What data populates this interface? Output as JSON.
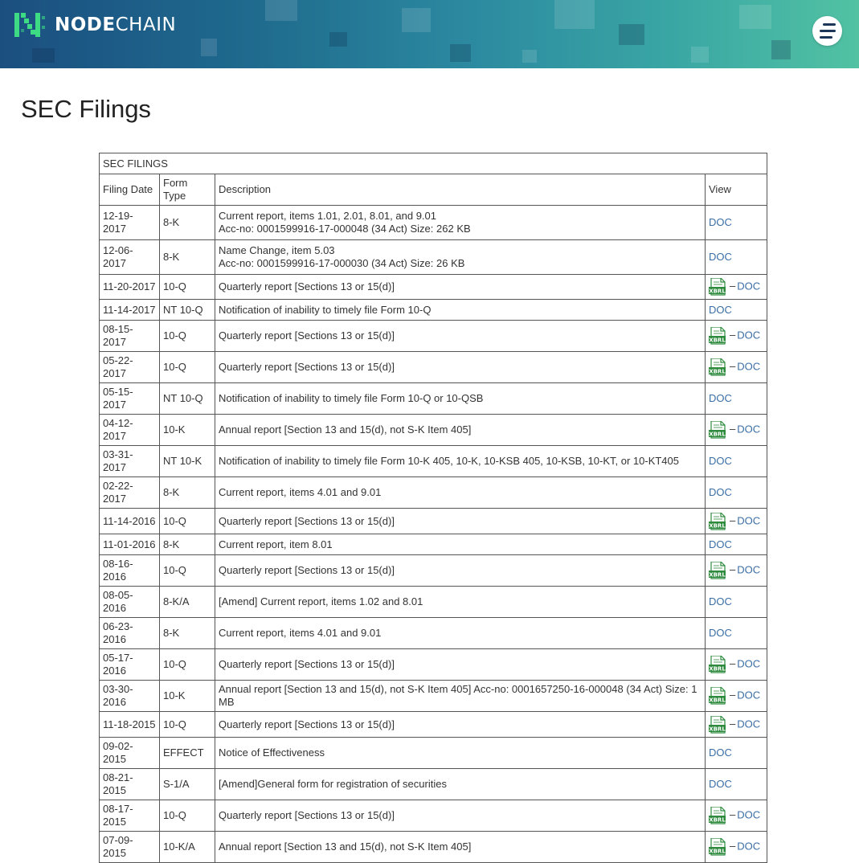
{
  "brand": {
    "prefix": "NODE",
    "suffix": "CHAIN"
  },
  "page_title": "SEC Filings",
  "table": {
    "caption": "SEC FILINGS",
    "columns": [
      "Filing Date",
      "Form Type",
      "Description",
      "View"
    ],
    "rows": [
      {
        "date": "12-19-2017",
        "form": "8-K",
        "desc": "Current report, items 1.01, 2.01, 8.01, and 9.01",
        "desc2": "Acc-no: 0001599916-17-000048 (34 Act) Size: 262 KB",
        "xbrl": false,
        "doc": "DOC"
      },
      {
        "date": "12-06-2017",
        "form": "8-K",
        "desc": "Name Change, item 5.03",
        "desc2": "Acc-no: 0001599916-17-000030 (34 Act) Size: 26 KB",
        "xbrl": false,
        "doc": "DOC"
      },
      {
        "date": "11-20-2017",
        "form": "10-Q",
        "desc": "Quarterly report [Sections 13 or 15(d)]",
        "xbrl": true,
        "doc": "DOC"
      },
      {
        "date": "11-14-2017",
        "form": "NT 10-Q",
        "desc": "Notification of inability to timely file Form 10-Q",
        "xbrl": false,
        "doc": "DOC"
      },
      {
        "date": "08-15-2017",
        "form": "10-Q",
        "desc": "Quarterly report [Sections 13 or 15(d)]",
        "xbrl": true,
        "doc": "DOC"
      },
      {
        "date": "05-22-2017",
        "form": "10-Q",
        "desc": "Quarterly report [Sections 13 or 15(d)]",
        "xbrl": true,
        "doc": "DOC"
      },
      {
        "date": "05-15-2017",
        "form": "NT 10-Q",
        "desc": "Notification of inability to timely file Form 10-Q or 10-QSB",
        "xbrl": false,
        "doc": "DOC"
      },
      {
        "date": "04-12-2017",
        "form": "10-K",
        "desc": "Annual report [Section 13 and 15(d), not S-K Item 405]",
        "xbrl": true,
        "doc": "DOC"
      },
      {
        "date": "03-31-2017",
        "form": "NT 10-K",
        "desc": "Notification of inability to timely file Form 10-K 405, 10-K, 10-KSB 405, 10-KSB, 10-KT, or 10-KT405",
        "xbrl": false,
        "doc": "DOC"
      },
      {
        "date": "02-22-2017",
        "form": "8-K",
        "desc": "Current report, items 4.01 and 9.01",
        "xbrl": false,
        "doc": "DOC"
      },
      {
        "date": "11-14-2016",
        "form": "10-Q",
        "desc": "Quarterly report [Sections 13 or 15(d)]",
        "xbrl": true,
        "doc": "DOC"
      },
      {
        "date": "11-01-2016",
        "form": "8-K",
        "desc": "Current report, item 8.01",
        "xbrl": false,
        "doc": "DOC"
      },
      {
        "date": "08-16-2016",
        "form": "10-Q",
        "desc": "Quarterly report [Sections 13 or 15(d)]",
        "xbrl": true,
        "doc": "DOC"
      },
      {
        "date": "08-05-2016",
        "form": "8-K/A",
        "desc": "[Amend] Current report, items 1.02 and 8.01",
        "xbrl": false,
        "doc": "DOC"
      },
      {
        "date": "06-23-2016",
        "form": "8-K",
        "desc": "Current report, items 4.01 and 9.01",
        "xbrl": false,
        "doc": "DOC"
      },
      {
        "date": "05-17-2016",
        "form": "10-Q",
        "desc": "Quarterly report [Sections 13 or 15(d)]",
        "xbrl": true,
        "doc": "DOC"
      },
      {
        "date": "03-30-2016",
        "form": "10-K",
        "desc": "Annual report [Section 13 and 15(d), not S-K Item 405] Acc-no: 0001657250-16-000048 (34 Act) Size: 1 MB",
        "xbrl": true,
        "doc": "DOC"
      },
      {
        "date": "11-18-2015",
        "form": "10-Q",
        "desc": "Quarterly report [Sections 13 or 15(d)]",
        "xbrl": true,
        "doc": "DOC"
      },
      {
        "date": "09-02-2015",
        "form": "EFFECT",
        "desc": "Notice of Effectiveness",
        "xbrl": false,
        "doc": "DOC"
      },
      {
        "date": "08-21-2015",
        "form": "S-1/A",
        "desc": "[Amend]General form for registration of securities",
        "xbrl": false,
        "doc": "DOC"
      },
      {
        "date": "08-17-2015",
        "form": "10-Q",
        "desc": "Quarterly report [Sections 13 or 15(d)]",
        "xbrl": true,
        "doc": "DOC"
      },
      {
        "date": "07-09-2015",
        "form": "10-K/A",
        "desc": "Annual report [Section 13 and 15(d), not S-K Item 405]",
        "xbrl": true,
        "doc": "DOC"
      }
    ]
  },
  "icons": {
    "menu": "menu-icon",
    "xbrl": "xbrl-file-icon",
    "logo": "nodechain-logo-icon"
  },
  "colors": {
    "link": "#3a6ea5",
    "header_start": "#1b4f80",
    "header_end": "#52c2a3",
    "xbrl_green": "#2e8b3e"
  }
}
